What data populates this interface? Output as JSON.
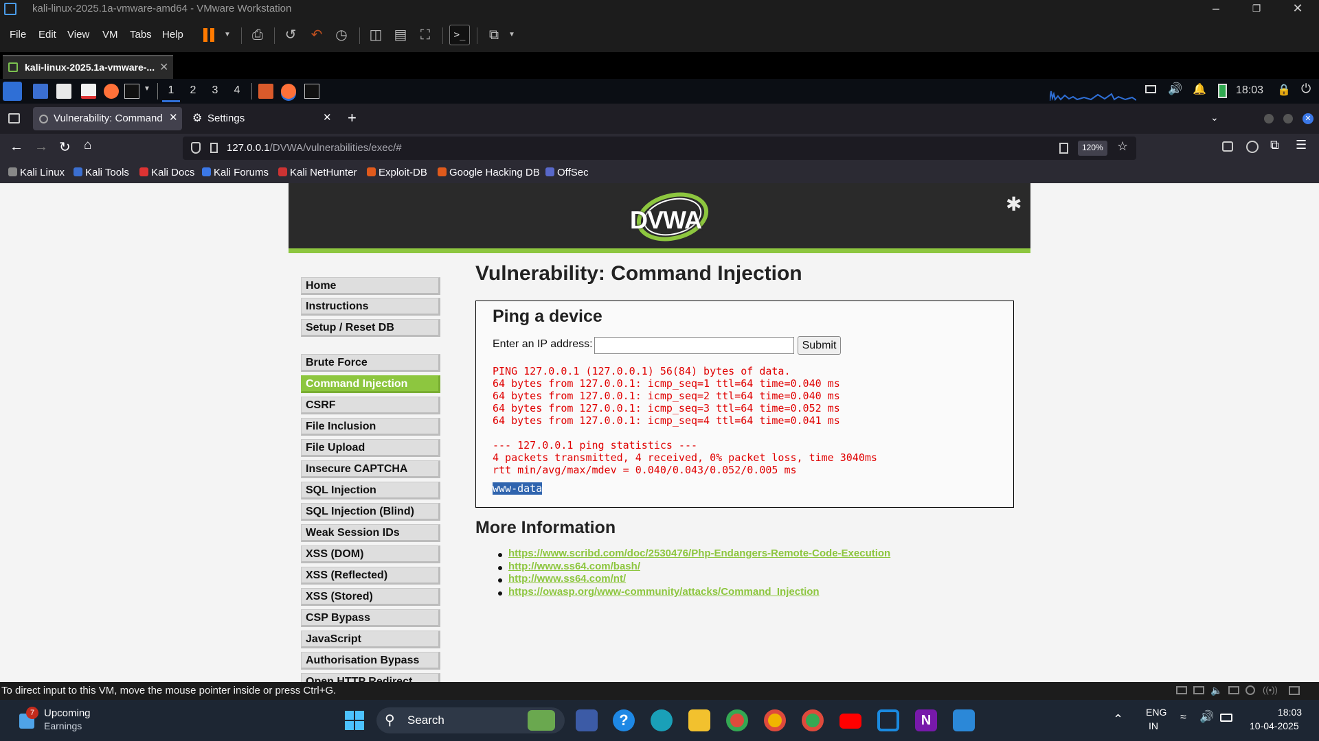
{
  "vm": {
    "title": "kali-linux-2025.1a-vmware-amd64 - VMware Workstation",
    "menu": [
      "File",
      "Edit",
      "View",
      "VM",
      "Tabs",
      "Help"
    ],
    "tab_label": "kali-linux-2025.1a-vmware-...",
    "status_text": "To direct input to this VM, move the mouse pointer inside or press Ctrl+G."
  },
  "kali_panel": {
    "workspaces": [
      "1",
      "2",
      "3",
      "4"
    ],
    "time": "18:03"
  },
  "firefox": {
    "tabs": [
      {
        "label": "Vulnerability: Command Inj"
      },
      {
        "label": "Settings"
      }
    ],
    "url_host": "127.0.0.1",
    "url_path": "/DVWA/vulnerabilities/exec/#",
    "zoom": "120%",
    "bookmarks": [
      "Kali Linux",
      "Kali Tools",
      "Kali Docs",
      "Kali Forums",
      "Kali NetHunter",
      "Exploit-DB",
      "Google Hacking DB",
      "OffSec"
    ]
  },
  "dvwa": {
    "logo": "DVWA",
    "menu": [
      {
        "label": "Home"
      },
      {
        "label": "Instructions"
      },
      {
        "label": "Setup / Reset DB"
      },
      {
        "label": "Brute Force"
      },
      {
        "label": "Command Injection"
      },
      {
        "label": "CSRF"
      },
      {
        "label": "File Inclusion"
      },
      {
        "label": "File Upload"
      },
      {
        "label": "Insecure CAPTCHA"
      },
      {
        "label": "SQL Injection"
      },
      {
        "label": "SQL Injection (Blind)"
      },
      {
        "label": "Weak Session IDs"
      },
      {
        "label": "XSS (DOM)"
      },
      {
        "label": "XSS (Reflected)"
      },
      {
        "label": "XSS (Stored)"
      },
      {
        "label": "CSP Bypass"
      },
      {
        "label": "JavaScript"
      },
      {
        "label": "Authorisation Bypass"
      },
      {
        "label": "Open HTTP Redirect"
      }
    ],
    "page_title": "Vulnerability: Command Injection",
    "box_title": "Ping a device",
    "ip_label": "Enter an IP address:",
    "ip_value": "",
    "submit_label": "Submit",
    "output": "PING 127.0.0.1 (127.0.0.1) 56(84) bytes of data.\n64 bytes from 127.0.0.1: icmp_seq=1 ttl=64 time=0.040 ms\n64 bytes from 127.0.0.1: icmp_seq=2 ttl=64 time=0.040 ms\n64 bytes from 127.0.0.1: icmp_seq=3 ttl=64 time=0.052 ms\n64 bytes from 127.0.0.1: icmp_seq=4 ttl=64 time=0.041 ms\n\n--- 127.0.0.1 ping statistics ---\n4 packets transmitted, 4 received, 0% packet loss, time 3040ms\nrtt min/avg/max/mdev = 0.040/0.043/0.052/0.005 ms",
    "selected_output": "www-data",
    "more_info_title": "More Information",
    "links": [
      "https://www.scribd.com/doc/2530476/Php-Endangers-Remote-Code-Execution",
      "http://www.ss64.com/bash/",
      "http://www.ss64.com/nt/",
      "https://owasp.org/www-community/attacks/Command_Injection"
    ]
  },
  "taskbar": {
    "widget_badge": "7",
    "widget_title": "Upcoming",
    "widget_sub": "Earnings",
    "search_label": "Search",
    "lang_top": "ENG",
    "lang_bottom": "IN",
    "time": "18:03",
    "date": "10-04-2025"
  },
  "colors": {
    "dvwa_accent": "#8dc63f",
    "output_red": "#e00000"
  }
}
